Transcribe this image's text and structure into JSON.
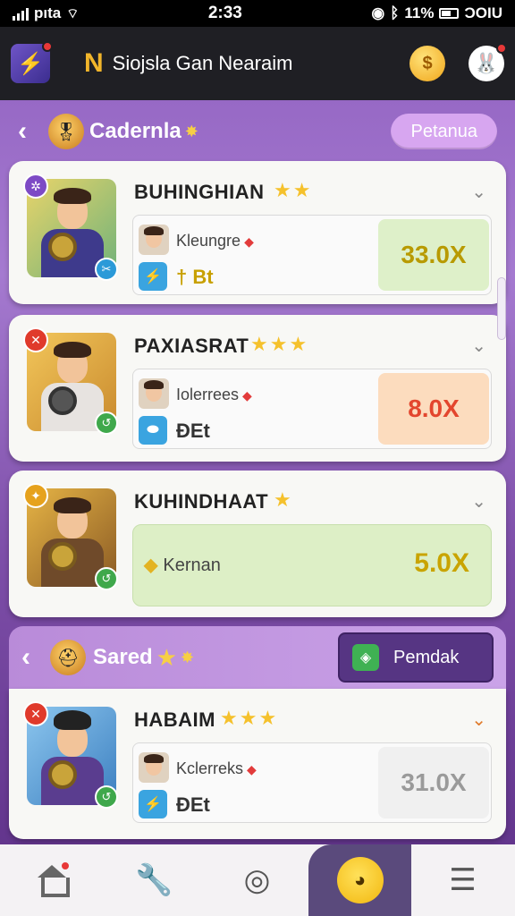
{
  "status_bar": {
    "carrier": "pıta",
    "time": "2:33",
    "battery_text": "11%",
    "network": "ƆOIU"
  },
  "app_bar": {
    "logo_letter": "N",
    "title": "Siojsla Gan Nearaim"
  },
  "section": {
    "title": "Cadernla",
    "action_label": "Petanua"
  },
  "cards": [
    {
      "name": "BUHINGHIAN",
      "stars": "★★",
      "player": "Kleungre",
      "bet": "† Bt",
      "odds": "33.0X",
      "odds_bg": "#def0c9",
      "odds_color": "#b89a00",
      "avatar_bg": "linear-gradient(135deg,#e8d46a,#6fb27a)",
      "body_color": "#3e3a8c",
      "badge_color": "#7d4ac5",
      "badge_icon": "✲"
    },
    {
      "name": "PAXIASRAT",
      "stars": "★★★",
      "player": "Iolerrees",
      "bet": "ĐEt",
      "odds": "8.0X",
      "odds_bg": "#fcdcbe",
      "odds_color": "#e3462e",
      "avatar_bg": "linear-gradient(135deg,#f2c65a,#c98a2e)",
      "body_color": "#e7e3e0",
      "badge_color": "#e03a2b",
      "badge_icon": "✕"
    },
    {
      "name": "KUHINDHAAT",
      "stars": "★",
      "label": "Kernan",
      "odds": "5.0X",
      "avatar_bg": "linear-gradient(135deg,#e6b445,#8a5a24)",
      "body_color": "#6f4a2a",
      "badge_color": "#e6a21d",
      "badge_icon": "✦"
    },
    {
      "name": "HABAIM",
      "stars": "★★★",
      "player": "Kclerreks",
      "bet": "ĐEt",
      "odds": "31.0X",
      "odds_bg": "#f0f0f0",
      "odds_color": "#9a9a9a",
      "avatar_bg": "linear-gradient(135deg,#8cc6ee,#3c7fc0)",
      "body_color": "#5a3d8f",
      "badge_color": "#e03a2b",
      "badge_icon": "✕"
    }
  ],
  "saved": {
    "title": "Sared",
    "button_label": "Pemdak"
  },
  "icons": {
    "back": "chevron-left-icon",
    "expand": "chevron-down-icon",
    "home": "home-icon",
    "tools": "wrench-icon",
    "target": "target-icon",
    "menu": "menu-icon"
  }
}
